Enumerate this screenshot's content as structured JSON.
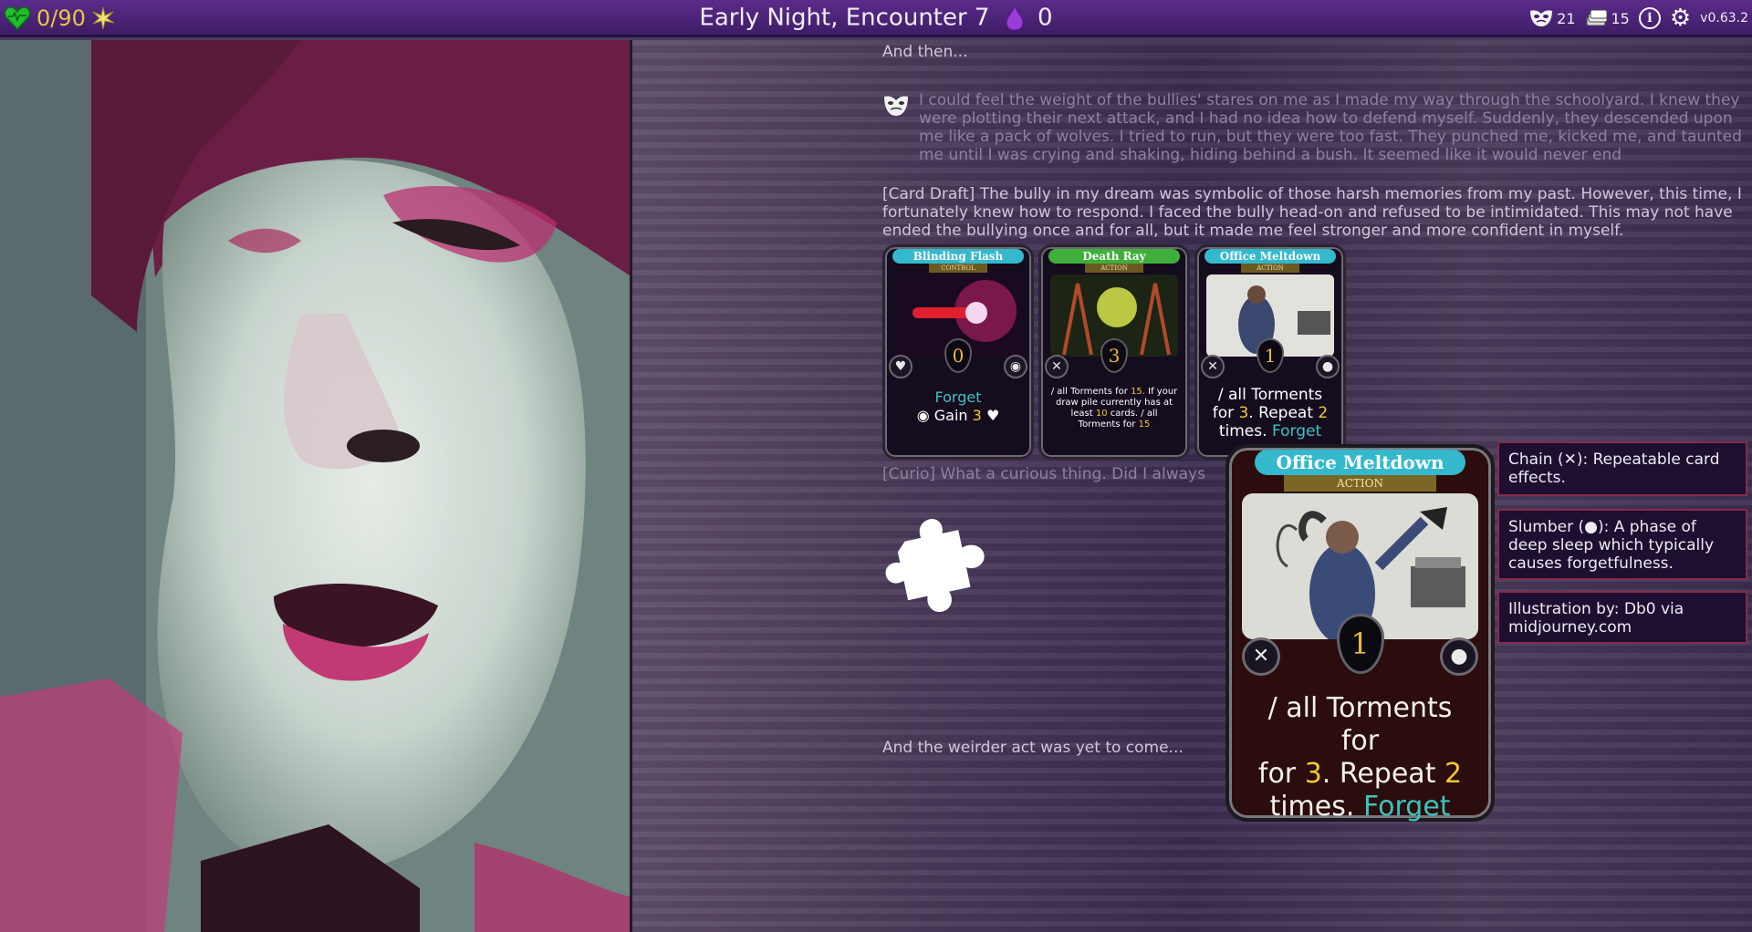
{
  "topbar": {
    "health": "0/90",
    "title": "Early Night, Encounter 7",
    "essence": "0",
    "deck_count": "21",
    "cards_count": "15",
    "info_icon_label": "i",
    "version": "v0.63.2"
  },
  "story": {
    "intro": "And then...",
    "memory": "I could feel the weight of the bullies' stares on me as I made my way through the schoolyard. I knew they were plotting their next attack, and I had no idea how to defend myself. Suddenly, they descended upon me like a pack of wolves. I tried to run, but they were too fast. They punched me, kicked me, and taunted me until I was crying and shaking, hiding behind a bush. It seemed like it would never end",
    "card_draft": "[Card Draft] The bully in my dream was symbolic of those harsh memories from my past. However, this time, I fortunately knew how to respond. I faced the bully head-on and refused to be intimidated. This may not have ended the bullying once and for all, but it made me feel stronger and more confident in myself.",
    "curio": "[Curio] What a curious thing. Did I always",
    "outro": "And the weirder act was yet to come..."
  },
  "cards": [
    {
      "title": "Blinding Flash",
      "type": "CONTROL",
      "cost": "0",
      "line1": "Forget",
      "gain_label": "Gain",
      "gain_value": "3",
      "title_color": "#34b8cc"
    },
    {
      "title": "Death Ray",
      "type": "ACTION",
      "cost": "3",
      "line1": "all Torments for",
      "val1": "15.",
      "line2": "If your draw pile currently has at least",
      "val2": "10",
      "line3": "cards",
      "line4": "all Torments for",
      "val4": "15",
      "title_color": "#3fae3a"
    },
    {
      "title": "Office Meltdown",
      "type": "ACTION",
      "cost": "1",
      "line1": "all Torments for",
      "val1": "3",
      "line2": ". Repeat",
      "val2": "2",
      "line3": "times.",
      "line4": "Forget",
      "title_color": "#34b8cc"
    }
  ],
  "bigcard": {
    "title": "Office Meltdown",
    "type": "ACTION",
    "cost": "1",
    "text_a": "all Torments for",
    "val_a": "3",
    "text_b": ". Repeat",
    "val_b": "2",
    "text_c": "times.",
    "forget": "Forget"
  },
  "tooltips": {
    "chain_a": "Chain (",
    "chain_b": "): Repeatable card effects.",
    "slumber_a": "Slumber (",
    "slumber_b": "): A phase of deep sleep which typically causes forgetfulness.",
    "illustration": "Illustration by: Db0 via midjourney.com"
  },
  "icons": [
    "heart-icon",
    "sparkle-icon",
    "drop-icon",
    "mask-icon",
    "cards-icon",
    "info-icon",
    "gear-icon",
    "puzzle-icon",
    "chain-icon",
    "slumber-icon"
  ],
  "colors": {
    "topbar": "#4a2278",
    "hp_text": "#e9c445",
    "accent_teal": "#34b8cc",
    "accent_yellow": "#f2c930",
    "tooltip_border": "#8a2a4a"
  }
}
